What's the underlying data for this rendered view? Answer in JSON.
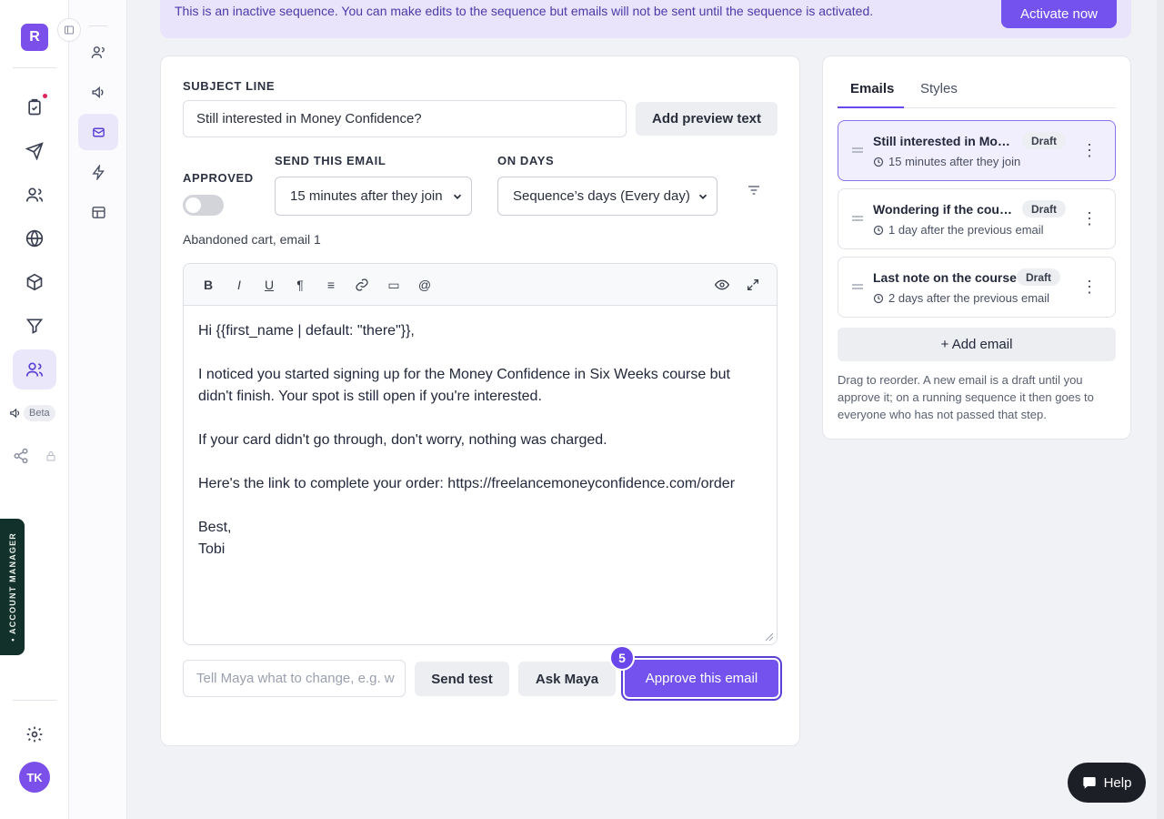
{
  "sidebar": {
    "logo_letter": "R",
    "beta_label": "Beta",
    "account_manager_label": "• ACCOUNT MANAGER",
    "user_initials": "TK"
  },
  "banner": {
    "message": "This is an inactive sequence. You can make edits to the sequence but emails will not be sent until the sequence is activated.",
    "activate_label": "Activate now"
  },
  "editor": {
    "subject_label": "SUBJECT LINE",
    "subject_value": "Still interested in Money Confidence?",
    "preview_button": "Add preview text",
    "approved_label": "APPROVED",
    "send_label": "SEND THIS EMAIL",
    "send_value": "15 minutes after they join",
    "days_label": "ON DAYS",
    "days_value": "Sequence’s days (Every day)",
    "caption": "Abandoned cart, email 1",
    "toolbar": {
      "bold": "B",
      "italic": "I",
      "underline": "U",
      "paragraph": "¶",
      "list": "≡",
      "hr": "▭",
      "mention": "@"
    },
    "body": [
      "Hi {{first_name | default: \"there\"}},",
      "",
      "I noticed you started signing up for the Money Confidence in Six Weeks course but didn't finish. Your spot is still open if you're interested.",
      "",
      "If your card didn't go through, don't worry, nothing was charged.",
      "",
      "Here's the link to complete your order: https://freelancemoneyconfidence.com/order",
      "",
      "Best,",
      "Tobi"
    ],
    "maya_placeholder": "Tell Maya what to change, e.g. w",
    "send_test": "Send test",
    "ask_maya": "Ask Maya",
    "approve": "Approve this email",
    "step_number": "5"
  },
  "emails_panel": {
    "tabs": [
      "Emails",
      "Styles"
    ],
    "items": [
      {
        "title": "Still interested in Mon…",
        "status": "Draft",
        "timing": "15 minutes after they join"
      },
      {
        "title": "Wondering if the cour…",
        "status": "Draft",
        "timing": "1 day after the previous email"
      },
      {
        "title": "Last note on the course",
        "status": "Draft",
        "timing": "2 days after the previous email"
      }
    ],
    "add_label": "+ Add email",
    "help_text": "Drag to reorder. A new email is a draft until you approve it; on a running sequence it then goes to everyone who has not passed that step."
  },
  "help_button": "Help",
  "colors": {
    "accent": "#7352ee",
    "banner_bg": "#e9e4fb",
    "selected_item": "#f1eefd"
  }
}
